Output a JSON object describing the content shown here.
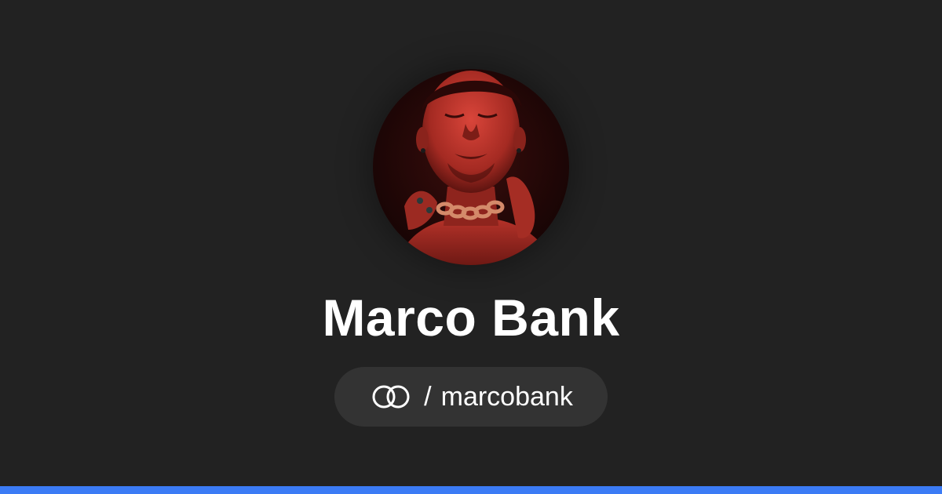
{
  "profile": {
    "name": "Marco Bank",
    "separator": "/",
    "username": "marcobank",
    "avatar_alt": "Marco Bank"
  },
  "icons": {
    "logo": "linked-rings-icon"
  },
  "colors": {
    "background": "#222222",
    "pill": "#333333",
    "text": "#ffffff",
    "accent_bar": "#3b7bf5",
    "avatar_tint": "#c2302a"
  }
}
